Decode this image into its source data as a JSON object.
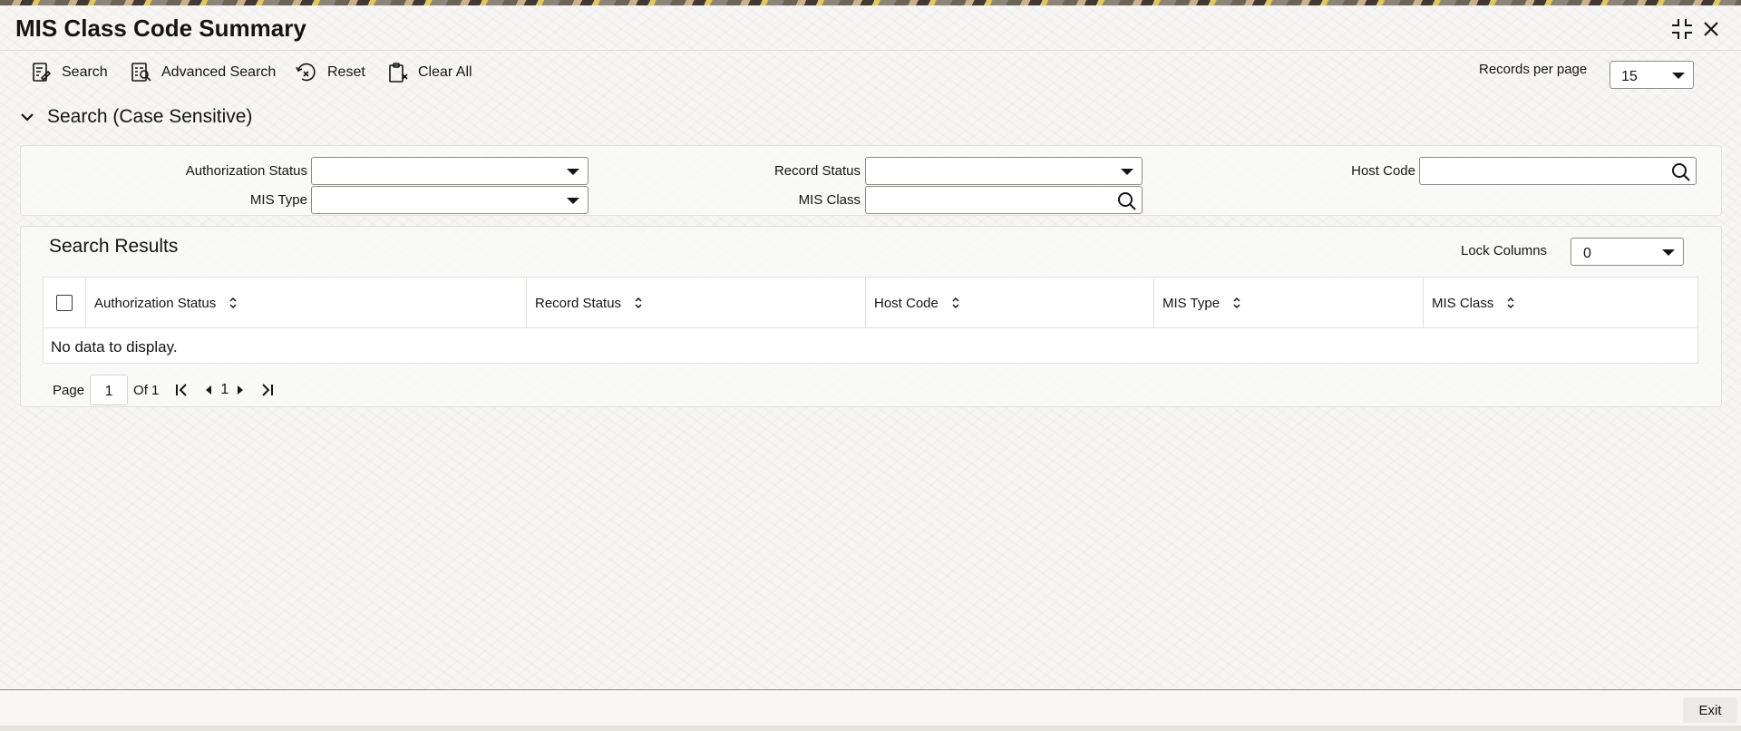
{
  "window": {
    "title": "MIS Class Code Summary",
    "maximize_icon": "compress-icon",
    "close_icon": "close-icon"
  },
  "toolbar": {
    "search_label": "Search",
    "advanced_search_label": "Advanced Search",
    "reset_label": "Reset",
    "clear_all_label": "Clear All",
    "records_per_page_label": "Records per page",
    "records_per_page_value": "15"
  },
  "search_section": {
    "title": "Search (Case Sensitive)",
    "fields": {
      "authorization_status": {
        "label": "Authorization Status",
        "value": ""
      },
      "record_status": {
        "label": "Record Status",
        "value": ""
      },
      "host_code": {
        "label": "Host Code",
        "value": ""
      },
      "mis_type": {
        "label": "MIS Type",
        "value": ""
      },
      "mis_class": {
        "label": "MIS Class",
        "value": ""
      }
    }
  },
  "results": {
    "title": "Search Results",
    "lock_columns_label": "Lock Columns",
    "lock_columns_value": "0",
    "columns": [
      "Authorization Status",
      "Record Status",
      "Host Code",
      "MIS Type",
      "MIS Class"
    ],
    "rows": [],
    "empty_message": "No data to display."
  },
  "pagination": {
    "page_label": "Page",
    "current_page": "1",
    "of_label": "Of 1",
    "page_number": "1"
  },
  "footer": {
    "exit_label": "Exit"
  }
}
